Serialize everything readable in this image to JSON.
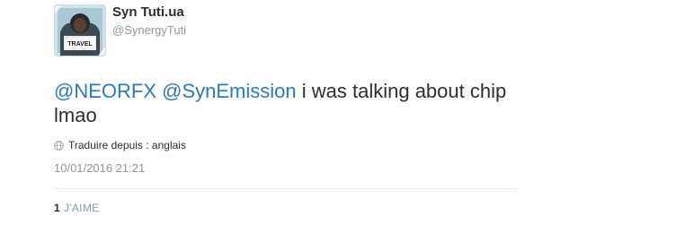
{
  "user": {
    "display_name": "Syn Tuti.ua",
    "handle": "@SynergyTuti",
    "avatar_label": "TRAVEL"
  },
  "tweet": {
    "mention_1": "@NEORFX",
    "mention_2": "@SynEmission",
    "text": " i was talking about chip lmao",
    "translate_label": "Traduire depuis : anglais",
    "timestamp": "10/01/2016 21:21"
  },
  "stats": {
    "likes_count": "1",
    "likes_label": "J'AIME"
  },
  "colors": {
    "link": "#2b7bb9",
    "muted": "#8899a6",
    "text": "#292f33",
    "divider": "#e1e8ed"
  },
  "icons": {
    "globe": "globe-icon"
  }
}
